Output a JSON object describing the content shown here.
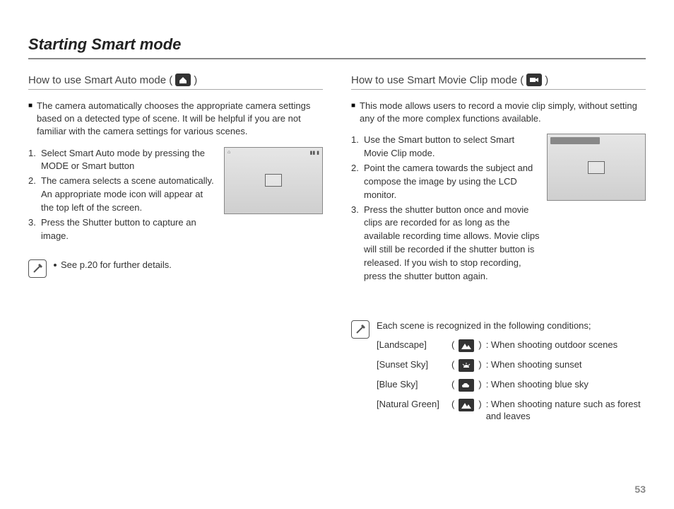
{
  "page_title": "Starting Smart mode",
  "page_number": "53",
  "left": {
    "heading_pre": "How to use Smart Auto mode (",
    "heading_post": ")",
    "mode_icon": "smart-auto-house-icon",
    "intro": "The camera automatically chooses the appropriate camera settings based on a detected type of scene. It will be helpful if you are not familiar with the camera settings for various scenes.",
    "steps": [
      "Select Smart Auto mode by pressing the MODE or Smart button",
      "The camera selects a scene automatically. An appropriate mode icon will appear at the top left of the screen.",
      "Press the Shutter button to capture an image."
    ],
    "note_bullet": "See p.20 for further details."
  },
  "right": {
    "heading_pre": "How to use Smart Movie Clip mode (",
    "heading_post": ")",
    "mode_icon": "smart-movie-icon",
    "intro": "This mode allows users to record a movie clip simply, without setting any of the more complex functions available.",
    "steps": [
      "Use the Smart button to select Smart Movie Clip mode.",
      "Point the camera towards the subject and compose the image by using the LCD monitor.",
      "Press the shutter button once and movie clips are recorded for as long as the available recording time allows. Movie clips will still be recorded if the shutter button is released. If you wish to stop recording, press the shutter button again."
    ],
    "scenes_intro": "Each scene is recognized in the following conditions;",
    "scenes": [
      {
        "label": "[Landscape]",
        "icon": "mountain-icon",
        "desc": ": When shooting outdoor scenes"
      },
      {
        "label": "[Sunset Sky]",
        "icon": "sunset-icon",
        "desc": ": When shooting sunset"
      },
      {
        "label": "[Blue Sky]",
        "icon": "cloud-icon",
        "desc": ": When shooting blue sky"
      },
      {
        "label": "[Natural Green]",
        "icon": "mountain-icon",
        "desc": ": When shooting nature such as forest and leaves"
      }
    ]
  }
}
